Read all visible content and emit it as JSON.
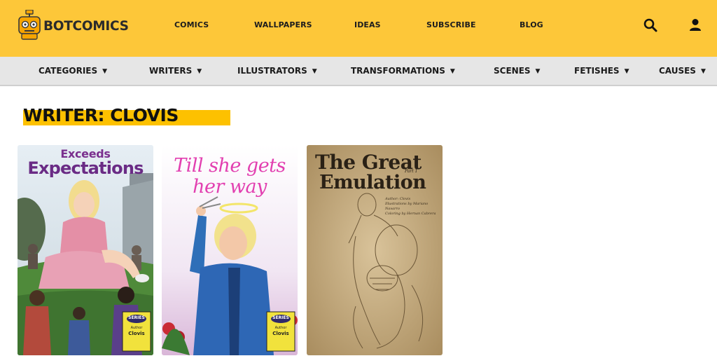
{
  "header": {
    "brand": "BOTCOMICS",
    "nav": [
      "COMICS",
      "WALLPAPERS",
      "IDEAS",
      "SUBSCRIBE",
      "BLOG"
    ],
    "icons": {
      "search": "search-icon",
      "account": "user-icon"
    },
    "background": "#fdc739"
  },
  "categories": {
    "items": [
      {
        "label": "CATEGORIES"
      },
      {
        "label": "WRITERS"
      },
      {
        "label": "ILLUSTRATORS"
      },
      {
        "label": "TRANSFORMATIONS"
      },
      {
        "label": "SCENES"
      },
      {
        "label": "FETISHES"
      },
      {
        "label": "CAUSES"
      }
    ],
    "caret": "▼"
  },
  "page": {
    "title": "WRITER: CLOVIS",
    "highlight_color": "#fdc100"
  },
  "comics": [
    {
      "title_line1": "Exceeds",
      "title_line2": "Expectations",
      "badge_series": "SERIES",
      "badge_author_label": "Author",
      "badge_author": "Clovis"
    },
    {
      "title_line1": "Till she gets",
      "title_line2": "her way",
      "badge_series": "SERIES",
      "badge_author_label": "Author",
      "badge_author": "Clovis"
    },
    {
      "title_line1": "The Great",
      "title_line2": "Emulation",
      "part": "Part 1",
      "credits": [
        "Author: Clovis",
        "Illustrations by Mariano Navarro",
        "Coloring by Hernan Cabrera"
      ]
    }
  ]
}
